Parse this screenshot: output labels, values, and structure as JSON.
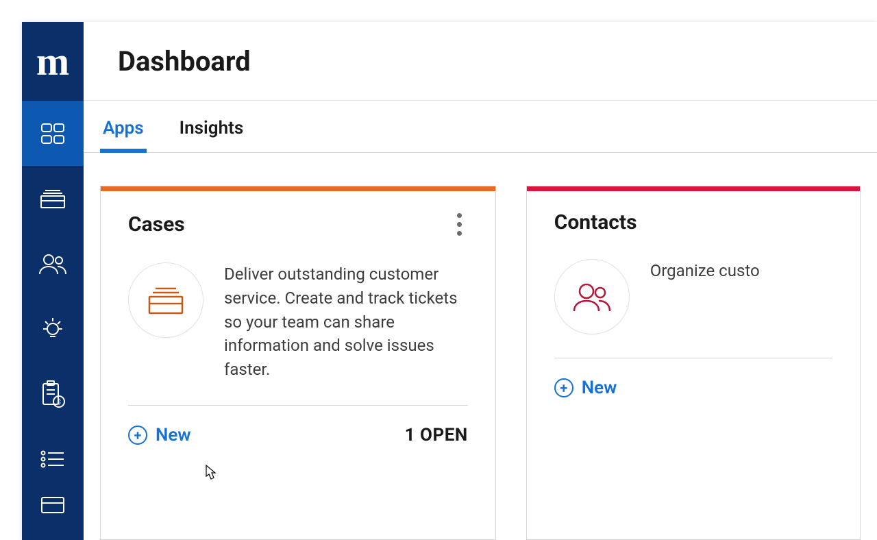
{
  "logo_text": "m",
  "header": {
    "title": "Dashboard"
  },
  "tabs": [
    {
      "label": "Apps",
      "active": true
    },
    {
      "label": "Insights",
      "active": false
    }
  ],
  "sidebar_items": [
    {
      "name": "dashboard",
      "active": true
    },
    {
      "name": "cases",
      "active": false
    },
    {
      "name": "contacts",
      "active": false
    },
    {
      "name": "ideas",
      "active": false
    },
    {
      "name": "billing",
      "active": false
    },
    {
      "name": "lists",
      "active": false
    },
    {
      "name": "more",
      "active": false
    }
  ],
  "cards": {
    "cases": {
      "title": "Cases",
      "stripe_color": "#e86a24",
      "icon_color": "#c25b19",
      "description": "Deliver outstanding customer service. Create and track tickets so your team can share information and solve issues faster.",
      "new_label": "New",
      "open_count_text": "1 OPEN"
    },
    "contacts": {
      "title": "Contacts",
      "stripe_color": "#d6163f",
      "icon_color": "#b21839",
      "description": "Organize custo",
      "new_label": "New"
    }
  }
}
